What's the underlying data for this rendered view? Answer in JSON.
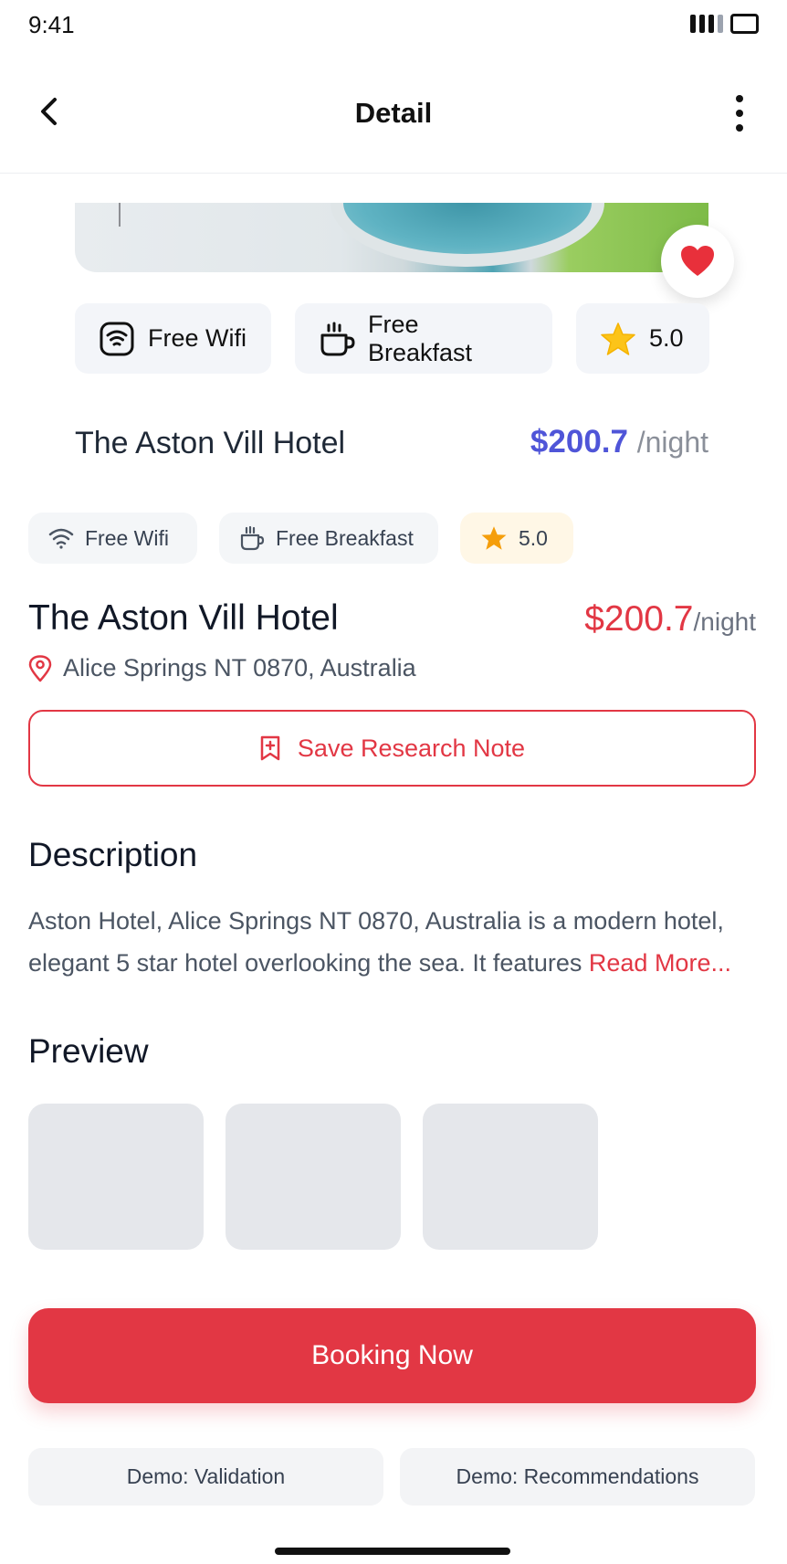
{
  "status_bar": {
    "time": "9:41"
  },
  "nav": {
    "title": "Detail"
  },
  "card": {
    "amenities": [
      {
        "label": "Free Wifi",
        "icon": "wifi-icon"
      },
      {
        "label": "Free Breakfast",
        "icon": "coffee-cup-icon"
      },
      {
        "label": "5.0",
        "icon": "star-icon"
      }
    ],
    "title": "The Aston Vill Hotel",
    "price": "$200.7",
    "price_unit": "/night"
  },
  "detail": {
    "amenities": [
      {
        "label": "Free Wifi",
        "icon": "wifi-icon"
      },
      {
        "label": "Free Breakfast",
        "icon": "coffee-cup-icon"
      },
      {
        "label": "5.0",
        "icon": "star-icon"
      }
    ],
    "title": "The Aston Vill Hotel",
    "price": "$200.7",
    "price_unit": "/night",
    "address": "Alice Springs NT 0870, Australia",
    "save_label": "Save Research Note"
  },
  "description": {
    "heading": "Description",
    "text": "Aston Hotel, Alice Springs NT 0870, Australia is a modern hotel, elegant 5 star hotel overlooking the sea. It features ",
    "read_more": "Read More..."
  },
  "preview": {
    "heading": "Preview"
  },
  "booking": {
    "label": "Booking Now"
  },
  "demo": {
    "validation_label": "Demo: Validation",
    "recommendations_label": "Demo: Recommendations"
  },
  "colors": {
    "accent": "#e23744",
    "price_indigo": "#4f55d8",
    "star": "#f59e0b"
  }
}
